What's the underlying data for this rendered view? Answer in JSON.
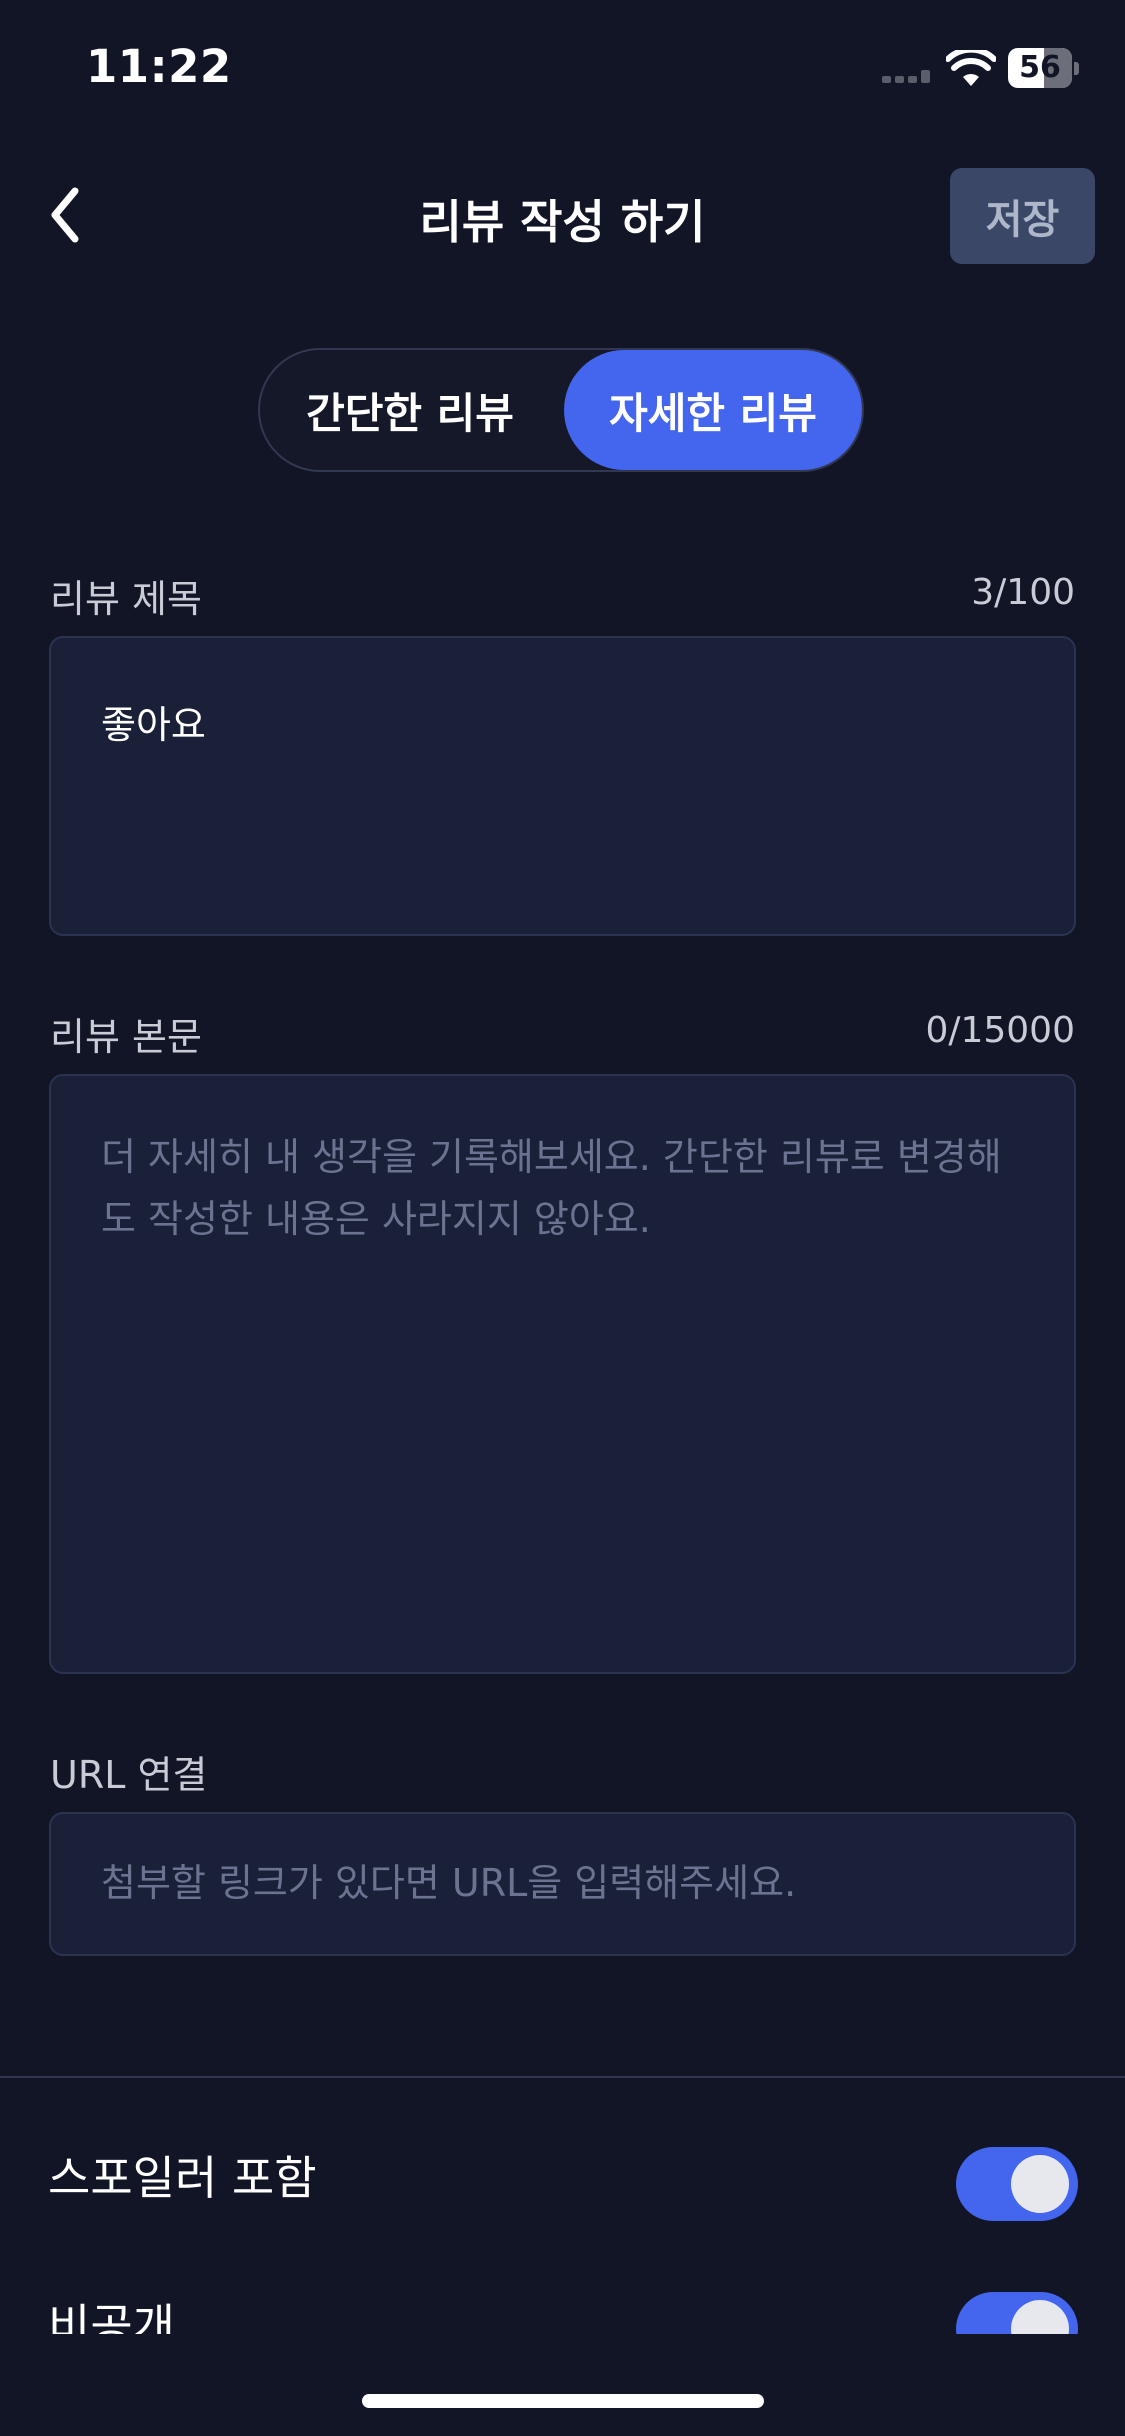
{
  "status_bar": {
    "time": "11:22",
    "battery_level": "56",
    "icons": [
      "signal-icon",
      "wifi-icon",
      "battery-icon"
    ]
  },
  "nav": {
    "back_icon": "chevron-left-icon",
    "title": "리뷰 작성 하기",
    "save_label": "저장"
  },
  "review_mode": {
    "options": [
      "간단한 리뷰",
      "자세한 리뷰"
    ],
    "selected": "자세한 리뷰"
  },
  "title_field": {
    "label": "리뷰 제목",
    "count": "3/100",
    "value": "좋아요"
  },
  "body_field": {
    "label": "리뷰 본문",
    "count": "0/15000",
    "placeholder_line1": "더 자세히 내 생각을 기록해보세요. 간단한 리뷰로 변경해",
    "placeholder_line2": "도 작성한 내용은 사라지지 않아요."
  },
  "url_field": {
    "label": "URL 연결",
    "placeholder": "첨부할 링크가 있다면 URL을 입력해주세요."
  },
  "settings": {
    "spoiler": {
      "label": "스포일러 포함",
      "on": true
    },
    "private": {
      "label": "비공개",
      "on": true
    }
  },
  "colors": {
    "background": "#121526",
    "accent": "#4466ee",
    "field_background": "#1a2038",
    "save_button": "#3b4766"
  }
}
